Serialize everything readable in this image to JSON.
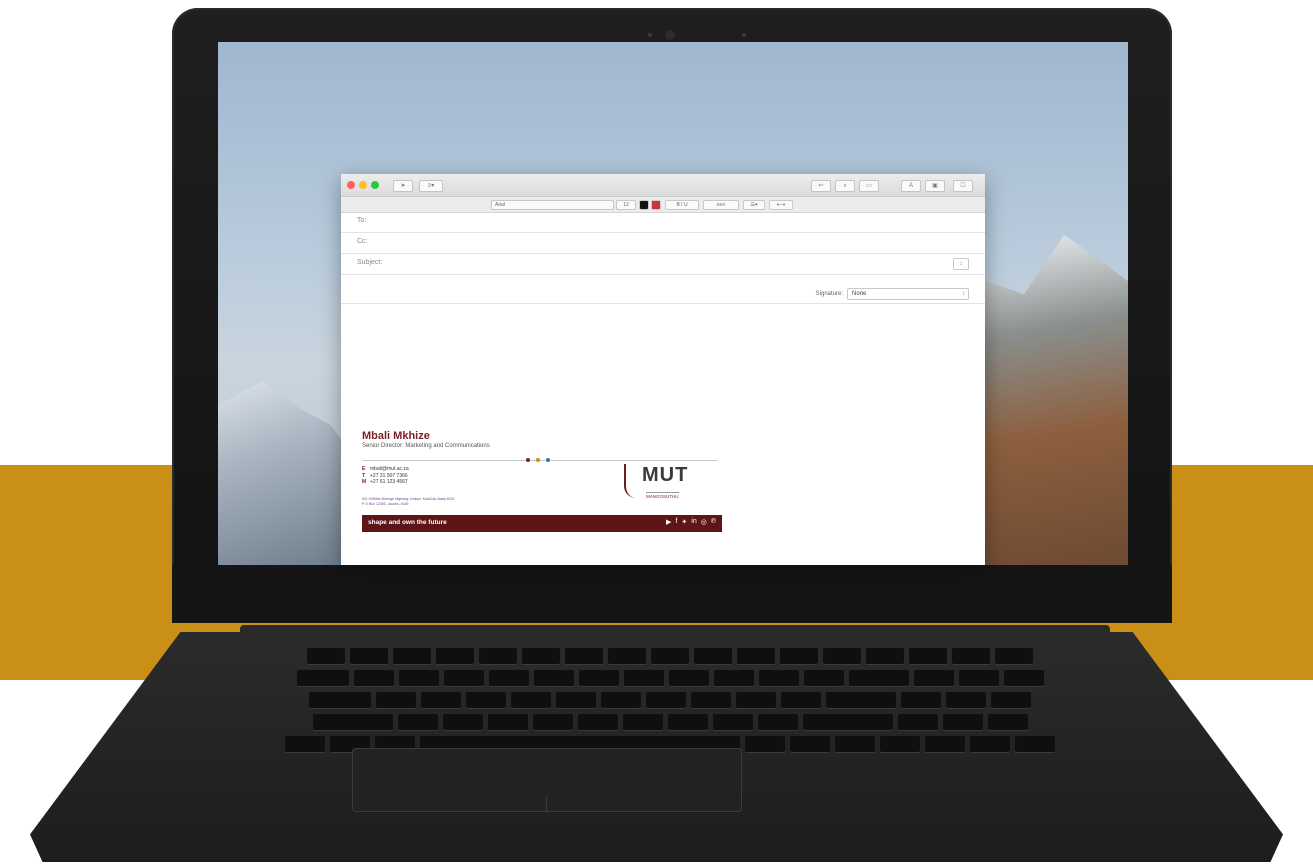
{
  "background": {
    "band_color": "#c98f17"
  },
  "mail_window": {
    "fields": {
      "to_label": "To:",
      "cc_label": "Cc:",
      "subject_label": "Subject:"
    },
    "signature_label": "Signature:",
    "signature_value": "None",
    "toolbar": {
      "font_name": "Arial",
      "font_size": "12"
    }
  },
  "signature": {
    "name": "Mbali Mkhize",
    "title": "Senior Director: Marketing and Communications",
    "email_label": "E",
    "email": "mbali@mut.ac.za",
    "phone_label": "T",
    "phone": "+27 31 907 7366",
    "mobile_label": "M",
    "mobile": "+27 61 123 4567",
    "address_line1": "511 Griffiths Mxenge Highway, Umlazi, KwaZulu-Natal 4031",
    "address_line2": "P O Box 12363, Jacobs, 4026",
    "logo_text": "MUT",
    "logo_subtext": "MANGOSUTHU",
    "slogan": "shape and own the future",
    "dot_colors": [
      "#7a1f22",
      "#c98f17",
      "#2a7ab8"
    ],
    "social_icons": [
      "youtube-icon",
      "facebook-icon",
      "twitter-icon",
      "linkedin-icon",
      "instagram-icon",
      "pinterest-icon"
    ]
  }
}
